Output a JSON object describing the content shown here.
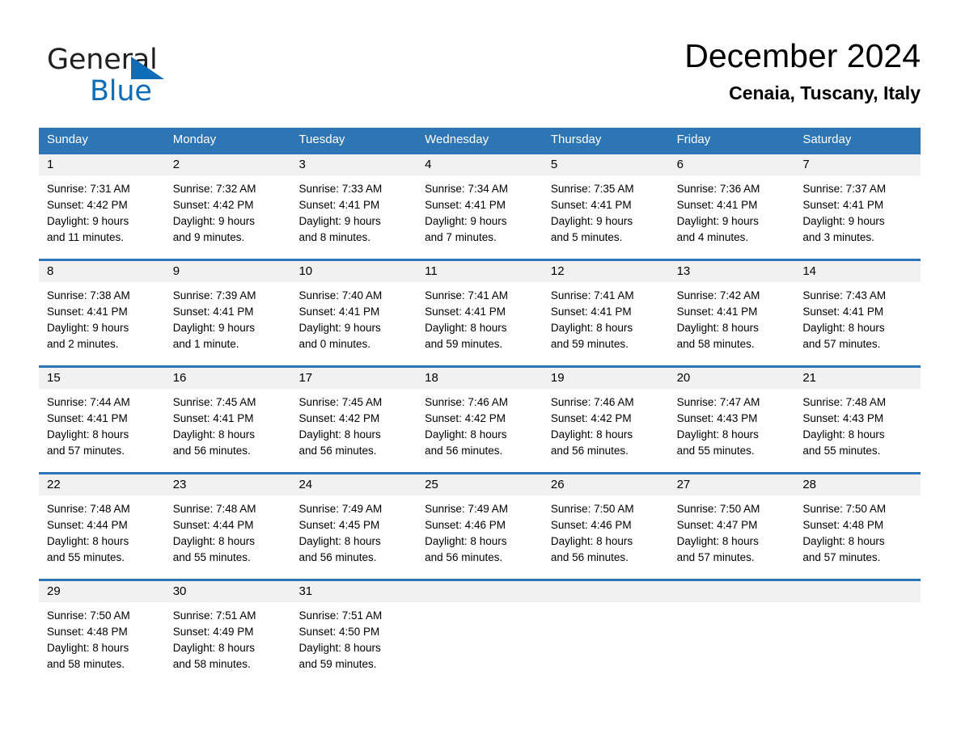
{
  "brand": {
    "word_one": "General",
    "word_two": "Blue",
    "triangle_icon": "brand-triangle-icon",
    "accent_color": "#0f6cb6"
  },
  "header": {
    "title": "December 2024",
    "location": "Cenaia, Tuscany, Italy"
  },
  "theme": {
    "header_blue": "#2e75b6",
    "row_divider_blue": "#2e75b6",
    "day_band_gray": "#f1f1f1",
    "text_black": "#000000",
    "weekday_text": "#ffffff"
  },
  "weekdays": [
    "Sunday",
    "Monday",
    "Tuesday",
    "Wednesday",
    "Thursday",
    "Friday",
    "Saturday"
  ],
  "weeks": [
    [
      {
        "day": "1",
        "sunrise": "Sunrise: 7:31 AM",
        "sunset": "Sunset: 4:42 PM",
        "daylight_line1": "Daylight: 9 hours",
        "daylight_line2": "and 11 minutes."
      },
      {
        "day": "2",
        "sunrise": "Sunrise: 7:32 AM",
        "sunset": "Sunset: 4:42 PM",
        "daylight_line1": "Daylight: 9 hours",
        "daylight_line2": "and 9 minutes."
      },
      {
        "day": "3",
        "sunrise": "Sunrise: 7:33 AM",
        "sunset": "Sunset: 4:41 PM",
        "daylight_line1": "Daylight: 9 hours",
        "daylight_line2": "and 8 minutes."
      },
      {
        "day": "4",
        "sunrise": "Sunrise: 7:34 AM",
        "sunset": "Sunset: 4:41 PM",
        "daylight_line1": "Daylight: 9 hours",
        "daylight_line2": "and 7 minutes."
      },
      {
        "day": "5",
        "sunrise": "Sunrise: 7:35 AM",
        "sunset": "Sunset: 4:41 PM",
        "daylight_line1": "Daylight: 9 hours",
        "daylight_line2": "and 5 minutes."
      },
      {
        "day": "6",
        "sunrise": "Sunrise: 7:36 AM",
        "sunset": "Sunset: 4:41 PM",
        "daylight_line1": "Daylight: 9 hours",
        "daylight_line2": "and 4 minutes."
      },
      {
        "day": "7",
        "sunrise": "Sunrise: 7:37 AM",
        "sunset": "Sunset: 4:41 PM",
        "daylight_line1": "Daylight: 9 hours",
        "daylight_line2": "and 3 minutes."
      }
    ],
    [
      {
        "day": "8",
        "sunrise": "Sunrise: 7:38 AM",
        "sunset": "Sunset: 4:41 PM",
        "daylight_line1": "Daylight: 9 hours",
        "daylight_line2": "and 2 minutes."
      },
      {
        "day": "9",
        "sunrise": "Sunrise: 7:39 AM",
        "sunset": "Sunset: 4:41 PM",
        "daylight_line1": "Daylight: 9 hours",
        "daylight_line2": "and 1 minute."
      },
      {
        "day": "10",
        "sunrise": "Sunrise: 7:40 AM",
        "sunset": "Sunset: 4:41 PM",
        "daylight_line1": "Daylight: 9 hours",
        "daylight_line2": "and 0 minutes."
      },
      {
        "day": "11",
        "sunrise": "Sunrise: 7:41 AM",
        "sunset": "Sunset: 4:41 PM",
        "daylight_line1": "Daylight: 8 hours",
        "daylight_line2": "and 59 minutes."
      },
      {
        "day": "12",
        "sunrise": "Sunrise: 7:41 AM",
        "sunset": "Sunset: 4:41 PM",
        "daylight_line1": "Daylight: 8 hours",
        "daylight_line2": "and 59 minutes."
      },
      {
        "day": "13",
        "sunrise": "Sunrise: 7:42 AM",
        "sunset": "Sunset: 4:41 PM",
        "daylight_line1": "Daylight: 8 hours",
        "daylight_line2": "and 58 minutes."
      },
      {
        "day": "14",
        "sunrise": "Sunrise: 7:43 AM",
        "sunset": "Sunset: 4:41 PM",
        "daylight_line1": "Daylight: 8 hours",
        "daylight_line2": "and 57 minutes."
      }
    ],
    [
      {
        "day": "15",
        "sunrise": "Sunrise: 7:44 AM",
        "sunset": "Sunset: 4:41 PM",
        "daylight_line1": "Daylight: 8 hours",
        "daylight_line2": "and 57 minutes."
      },
      {
        "day": "16",
        "sunrise": "Sunrise: 7:45 AM",
        "sunset": "Sunset: 4:41 PM",
        "daylight_line1": "Daylight: 8 hours",
        "daylight_line2": "and 56 minutes."
      },
      {
        "day": "17",
        "sunrise": "Sunrise: 7:45 AM",
        "sunset": "Sunset: 4:42 PM",
        "daylight_line1": "Daylight: 8 hours",
        "daylight_line2": "and 56 minutes."
      },
      {
        "day": "18",
        "sunrise": "Sunrise: 7:46 AM",
        "sunset": "Sunset: 4:42 PM",
        "daylight_line1": "Daylight: 8 hours",
        "daylight_line2": "and 56 minutes."
      },
      {
        "day": "19",
        "sunrise": "Sunrise: 7:46 AM",
        "sunset": "Sunset: 4:42 PM",
        "daylight_line1": "Daylight: 8 hours",
        "daylight_line2": "and 56 minutes."
      },
      {
        "day": "20",
        "sunrise": "Sunrise: 7:47 AM",
        "sunset": "Sunset: 4:43 PM",
        "daylight_line1": "Daylight: 8 hours",
        "daylight_line2": "and 55 minutes."
      },
      {
        "day": "21",
        "sunrise": "Sunrise: 7:48 AM",
        "sunset": "Sunset: 4:43 PM",
        "daylight_line1": "Daylight: 8 hours",
        "daylight_line2": "and 55 minutes."
      }
    ],
    [
      {
        "day": "22",
        "sunrise": "Sunrise: 7:48 AM",
        "sunset": "Sunset: 4:44 PM",
        "daylight_line1": "Daylight: 8 hours",
        "daylight_line2": "and 55 minutes."
      },
      {
        "day": "23",
        "sunrise": "Sunrise: 7:48 AM",
        "sunset": "Sunset: 4:44 PM",
        "daylight_line1": "Daylight: 8 hours",
        "daylight_line2": "and 55 minutes."
      },
      {
        "day": "24",
        "sunrise": "Sunrise: 7:49 AM",
        "sunset": "Sunset: 4:45 PM",
        "daylight_line1": "Daylight: 8 hours",
        "daylight_line2": "and 56 minutes."
      },
      {
        "day": "25",
        "sunrise": "Sunrise: 7:49 AM",
        "sunset": "Sunset: 4:46 PM",
        "daylight_line1": "Daylight: 8 hours",
        "daylight_line2": "and 56 minutes."
      },
      {
        "day": "26",
        "sunrise": "Sunrise: 7:50 AM",
        "sunset": "Sunset: 4:46 PM",
        "daylight_line1": "Daylight: 8 hours",
        "daylight_line2": "and 56 minutes."
      },
      {
        "day": "27",
        "sunrise": "Sunrise: 7:50 AM",
        "sunset": "Sunset: 4:47 PM",
        "daylight_line1": "Daylight: 8 hours",
        "daylight_line2": "and 57 minutes."
      },
      {
        "day": "28",
        "sunrise": "Sunrise: 7:50 AM",
        "sunset": "Sunset: 4:48 PM",
        "daylight_line1": "Daylight: 8 hours",
        "daylight_line2": "and 57 minutes."
      }
    ],
    [
      {
        "day": "29",
        "sunrise": "Sunrise: 7:50 AM",
        "sunset": "Sunset: 4:48 PM",
        "daylight_line1": "Daylight: 8 hours",
        "daylight_line2": "and 58 minutes."
      },
      {
        "day": "30",
        "sunrise": "Sunrise: 7:51 AM",
        "sunset": "Sunset: 4:49 PM",
        "daylight_line1": "Daylight: 8 hours",
        "daylight_line2": "and 58 minutes."
      },
      {
        "day": "31",
        "sunrise": "Sunrise: 7:51 AM",
        "sunset": "Sunset: 4:50 PM",
        "daylight_line1": "Daylight: 8 hours",
        "daylight_line2": "and 59 minutes."
      },
      {
        "day": "",
        "sunrise": "",
        "sunset": "",
        "daylight_line1": "",
        "daylight_line2": ""
      },
      {
        "day": "",
        "sunrise": "",
        "sunset": "",
        "daylight_line1": "",
        "daylight_line2": ""
      },
      {
        "day": "",
        "sunrise": "",
        "sunset": "",
        "daylight_line1": "",
        "daylight_line2": ""
      },
      {
        "day": "",
        "sunrise": "",
        "sunset": "",
        "daylight_line1": "",
        "daylight_line2": ""
      }
    ]
  ]
}
